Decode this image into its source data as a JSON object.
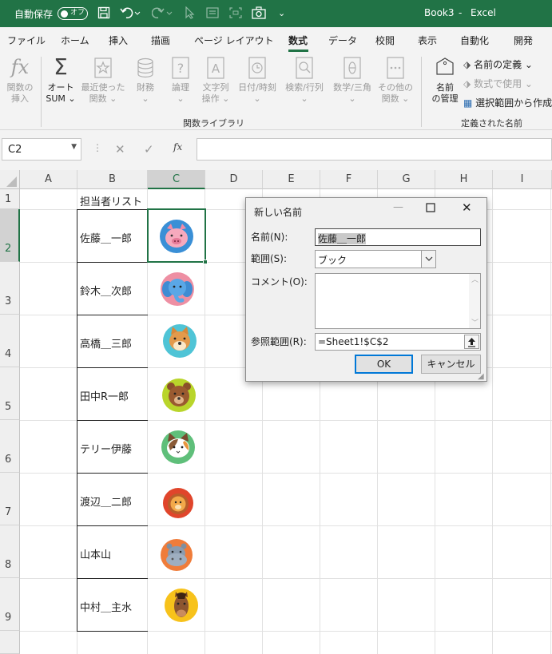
{
  "titlebar": {
    "autosave_label": "自動保存",
    "autosave_state": "オフ",
    "filename": "Book3",
    "separator": "-",
    "app": "Excel",
    "color": "#217346"
  },
  "tabs": [
    "ファイル",
    "ホーム",
    "挿入",
    "描画",
    "ページ レイアウト",
    "数式",
    "データ",
    "校閲",
    "表示",
    "自動化",
    "開発"
  ],
  "active_tab": "数式",
  "ribbon": {
    "insert_function": [
      "関数の",
      "挿入"
    ],
    "autosum": [
      "オート",
      "SUM ⌄"
    ],
    "recent": [
      "最近使った",
      "関数 ⌄"
    ],
    "financial": [
      "財務",
      "⌄"
    ],
    "logical": [
      "論理",
      "⌄"
    ],
    "text": [
      "文字列",
      "操作 ⌄"
    ],
    "datetime": [
      "日付/時刻",
      "⌄"
    ],
    "lookup": [
      "検索/行列",
      "⌄"
    ],
    "math": [
      "数学/三角",
      "⌄"
    ],
    "more": [
      "その他の",
      "関数 ⌄"
    ],
    "group_library": "関数ライブラリ",
    "name_manager": [
      "名前",
      "の管理"
    ],
    "define_name": "名前の定義 ⌄",
    "use_in_formula": "数式で使用 ⌄",
    "create_from_selection": "選択範囲から作成",
    "group_names": "定義された名前"
  },
  "formula_bar": {
    "name_box": "C2",
    "fx": "fx",
    "value": ""
  },
  "columns": [
    "A",
    "B",
    "C",
    "D",
    "E",
    "F",
    "G",
    "H",
    "I"
  ],
  "selected_column": "C",
  "rows": [
    "1",
    "2",
    "3",
    "4",
    "5",
    "6",
    "7",
    "8",
    "9"
  ],
  "selected_row": "2",
  "sheet": {
    "header": "担当者リスト",
    "names": [
      "佐藤＿一郎",
      "鈴木＿次郎",
      "高橋＿三郎",
      "田中R一郎",
      "テリー伊藤",
      "渡辺＿二郎",
      "山本山",
      "中村＿主水"
    ],
    "animals": [
      "pig-icon",
      "elephant-icon",
      "shiba-dog-icon",
      "bear-icon",
      "calico-cat-icon",
      "lion-icon",
      "hippo-icon",
      "horse-icon"
    ]
  },
  "dialog": {
    "title": "新しい名前",
    "name_label": "名前(N):",
    "name_value": "佐藤＿一郎",
    "scope_label": "範囲(S):",
    "scope_value": "ブック",
    "comment_label": "コメント(O):",
    "comment_value": "",
    "refers_label": "参照範囲(R):",
    "refers_value": "=Sheet1!$C$2",
    "ok": "OK",
    "cancel": "キャンセル"
  }
}
